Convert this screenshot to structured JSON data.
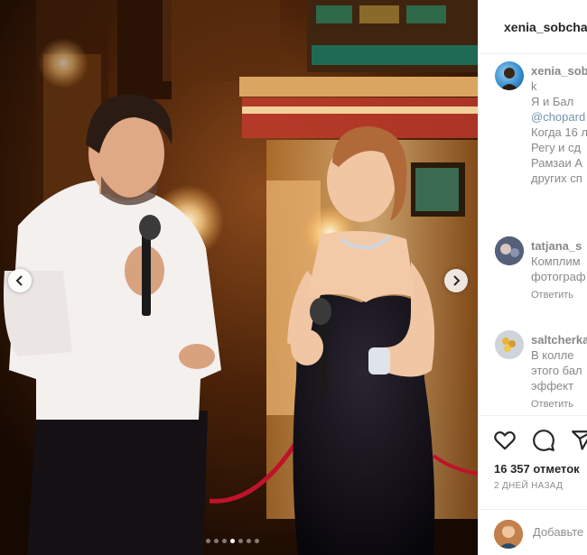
{
  "post": {
    "username": "xenia_sobchak",
    "carousel": {
      "count": 7,
      "active_index": 3
    }
  },
  "caption": {
    "username": "xenia_sobc",
    "lines": [
      "k",
      "Я и Бал",
      "@chopard",
      "Когда 16 л",
      "Регу и сд",
      "Рамзаи А",
      "других сп"
    ]
  },
  "comments": [
    {
      "username": "tatjana_s",
      "lines": [
        "Комплим",
        "фотограф"
      ],
      "meta": "Ответить"
    },
    {
      "username": "saltcherkas",
      "lines": [
        "В колле",
        "этого бал",
        "эффект"
      ],
      "meta": "Ответить"
    }
  ],
  "actions": {
    "likes": "16 357 отметок",
    "date": "2 ДНЕЙ НАЗАД",
    "comment_placeholder": "Добавьте"
  },
  "icons": [
    "heart-icon",
    "comment-icon",
    "share-icon",
    "chevron-left-icon",
    "chevron-right-icon"
  ],
  "colors": {
    "link": "#00376b",
    "muted": "#8e8e8e",
    "border": "#efefef"
  }
}
